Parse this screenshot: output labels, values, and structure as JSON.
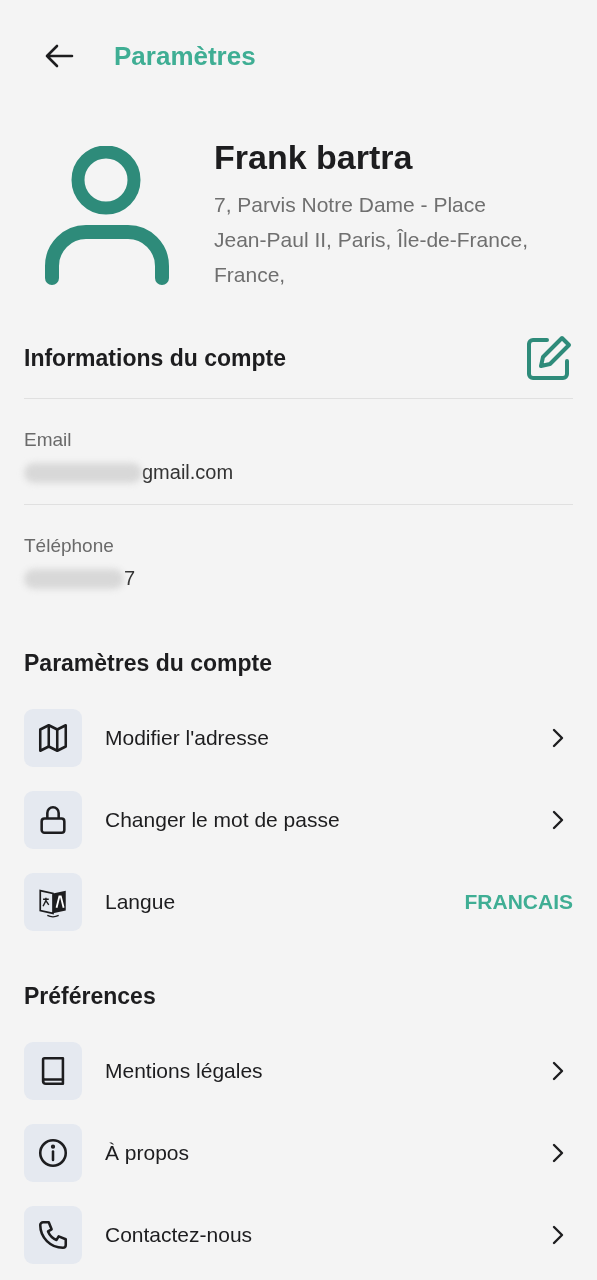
{
  "header": {
    "title": "Paramètres"
  },
  "profile": {
    "name": "Frank bartra",
    "address": "7, Parvis Notre Dame - Place Jean-Paul II, Paris, Île-de-France, France,"
  },
  "account_info": {
    "title": "Informations du compte",
    "fields": [
      {
        "label": "Email",
        "value": "gmail.com"
      },
      {
        "label": "Téléphone",
        "value": "7"
      }
    ]
  },
  "sections": [
    {
      "title": "Paramètres du compte",
      "items": [
        {
          "label": "Modifier l'adresse",
          "kind": "link"
        },
        {
          "label": "Changer le mot de passe",
          "kind": "link"
        },
        {
          "label": "Langue",
          "kind": "value",
          "value": "FRANCAIS"
        }
      ]
    },
    {
      "title": "Préférences",
      "items": [
        {
          "label": "Mentions légales",
          "kind": "link"
        },
        {
          "label": "À propos",
          "kind": "link"
        },
        {
          "label": "Contactez-nous",
          "kind": "link"
        }
      ]
    }
  ]
}
